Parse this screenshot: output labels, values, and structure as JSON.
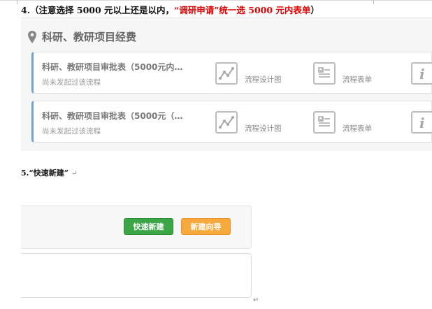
{
  "heading4": {
    "prefix": "4.（注意选择 5000 元以上还是以内，",
    "highlight": "“调研申请”统一选 5000 元内表单",
    "suffix": "）"
  },
  "panel": {
    "title": "科研、教研项目经费",
    "cards": [
      {
        "title": "科研、教研项目审批表（5000元内…",
        "subtitle": "尚未发起过该流程",
        "action1_label": "流程设计图",
        "action2_label": "流程表单",
        "action1_icon": "chart-line-icon",
        "action2_icon": "form-icon",
        "action3_icon": "info-icon"
      },
      {
        "title": "科研、教研项目审批表（5000元（…",
        "subtitle": "尚未发起过该流程",
        "action1_label": "流程设计图",
        "action2_label": "流程表单",
        "action1_icon": "chart-line-icon",
        "action2_icon": "form-icon",
        "action3_icon": "info-icon"
      }
    ],
    "accent_color": "#6ea2d8"
  },
  "heading5": {
    "text": "5.“快速新建”",
    "return_mark": "↵"
  },
  "buttons": {
    "quick_new": "快速新建",
    "wizard": "新建向导",
    "quick_new_color": "#3aa645",
    "wizard_color": "#f7a93b"
  },
  "end_mark": "↵"
}
